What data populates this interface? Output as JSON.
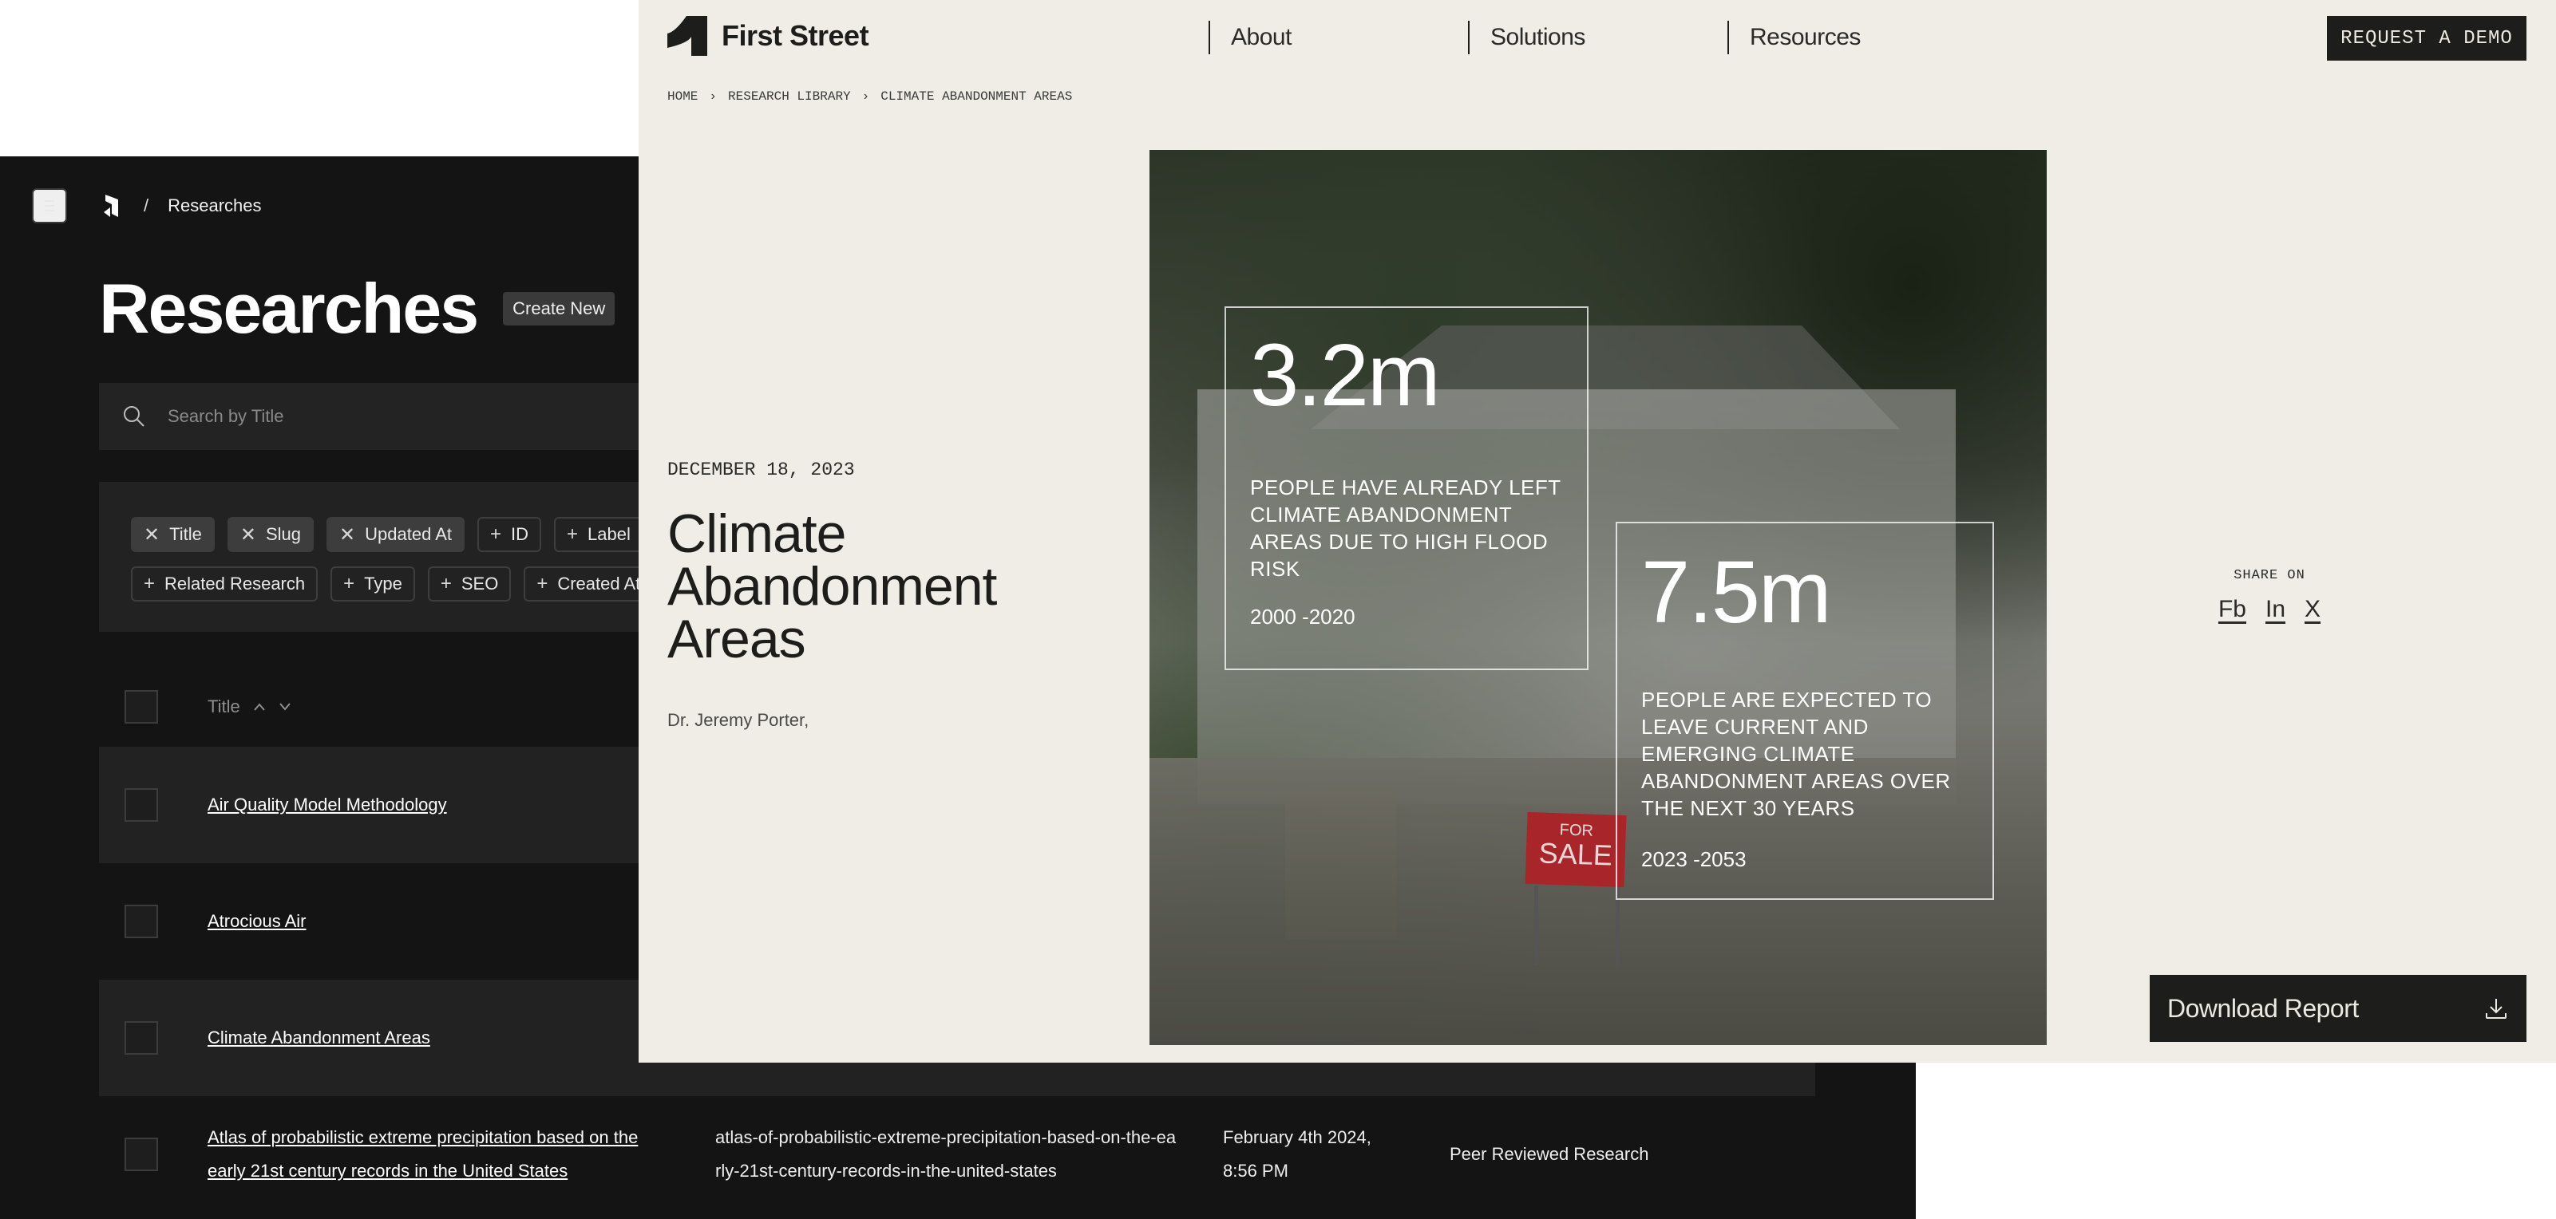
{
  "cms": {
    "breadcrumb": {
      "separator": "/",
      "current": "Researches"
    },
    "page_title": "Researches",
    "create_button": "Create New",
    "search": {
      "placeholder": "Search by Title",
      "value": ""
    },
    "column_chips": [
      [
        {
          "label": "Title",
          "active": true,
          "icon": "close-icon",
          "glyph": "✕"
        },
        {
          "label": "Slug",
          "active": true,
          "icon": "close-icon",
          "glyph": "✕"
        },
        {
          "label": "Updated At",
          "active": true,
          "icon": "close-icon",
          "glyph": "✕"
        },
        {
          "label": "ID",
          "active": false,
          "icon": "plus-icon",
          "glyph": "+"
        },
        {
          "label": "Label",
          "active": false,
          "icon": "plus-icon",
          "glyph": "+"
        }
      ],
      [
        {
          "label": "Related Research",
          "active": false,
          "icon": "plus-icon",
          "glyph": "+"
        },
        {
          "label": "Type",
          "active": false,
          "icon": "plus-icon",
          "glyph": "+"
        },
        {
          "label": "SEO",
          "active": false,
          "icon": "plus-icon",
          "glyph": "+"
        },
        {
          "label": "Created At",
          "active": false,
          "icon": "plus-icon",
          "glyph": "+"
        }
      ]
    ],
    "table": {
      "header": {
        "title": "Title",
        "sort_up": "^",
        "sort_down": "v"
      },
      "rows": [
        {
          "title": "Air Quality Model Methodology",
          "slug": "",
          "updated": "",
          "type": ""
        },
        {
          "title": "Atrocious Air",
          "slug": "",
          "updated": "",
          "type": ""
        },
        {
          "title": "Climate Abandonment Areas",
          "slug": "",
          "updated": "",
          "type": ""
        },
        {
          "title": "Atlas of probabilistic extreme precipitation based on the early 21st century records in the United States",
          "slug": "atlas-of-probabilistic-extreme-precipitation-based-on-the-early-21st-century-records-in-the-united-states",
          "updated": "February 4th 2024, 8:56 PM",
          "type": "Peer Reviewed Research"
        }
      ]
    }
  },
  "site": {
    "brand": "First Street",
    "nav": [
      "About",
      "Solutions",
      "Resources"
    ],
    "cta": "REQUEST A DEMO",
    "breadcrumb": [
      "HOME",
      "RESEARCH LIBRARY",
      "CLIMATE ABANDONMENT AREAS"
    ],
    "breadcrumb_sep": "›",
    "article": {
      "date": "DECEMBER 18, 2023",
      "title": "Climate Abandonment Areas",
      "author": "Dr. Jeremy Porter,"
    },
    "hero": {
      "sign_top": "FOR",
      "sign_bottom": "SALE",
      "stats": [
        {
          "value": "3.2m",
          "description": "PEOPLE HAVE ALREADY LEFT CLIMATE ABANDONMENT AREAS DUE TO HIGH FLOOD RISK",
          "range": "2000 -2020"
        },
        {
          "value": "7.5m",
          "description": "PEOPLE ARE EXPECTED TO LEAVE CURRENT AND EMERGING CLIMATE ABANDONMENT AREAS OVER THE NEXT 30 YEARS",
          "range": "2023 -2053"
        }
      ]
    },
    "share": {
      "label": "SHARE ON",
      "links": [
        "Fb",
        "In",
        "X"
      ]
    },
    "download": "Download Report"
  }
}
